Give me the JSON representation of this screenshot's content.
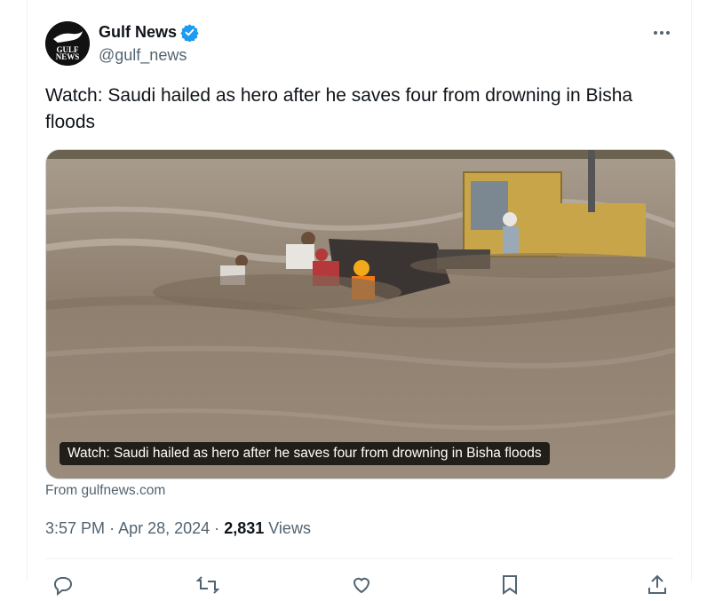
{
  "account": {
    "display_name": "Gulf News",
    "handle": "@gulf_news",
    "avatar_logo_text": "GULF NEWS"
  },
  "tweet": {
    "text": "Watch: Saudi hailed as hero after he saves four from drowning in Bisha floods",
    "video_caption": "Watch: Saudi hailed as hero after he saves four from drowning in Bisha floods",
    "source": "From gulfnews.com",
    "time": "3:57 PM",
    "separator": "·",
    "date": "Apr 28, 2024",
    "views_count": "2,831",
    "views_label": "Views"
  },
  "icons": {
    "verified": "verified-badge-icon",
    "more": "more-options-icon",
    "reply": "reply-icon",
    "retweet": "retweet-icon",
    "like": "like-icon",
    "bookmark": "bookmark-icon",
    "share": "share-icon"
  },
  "colors": {
    "verified_blue": "#1d9bf0",
    "secondary_text": "#536471",
    "primary_text": "#0f1419"
  }
}
